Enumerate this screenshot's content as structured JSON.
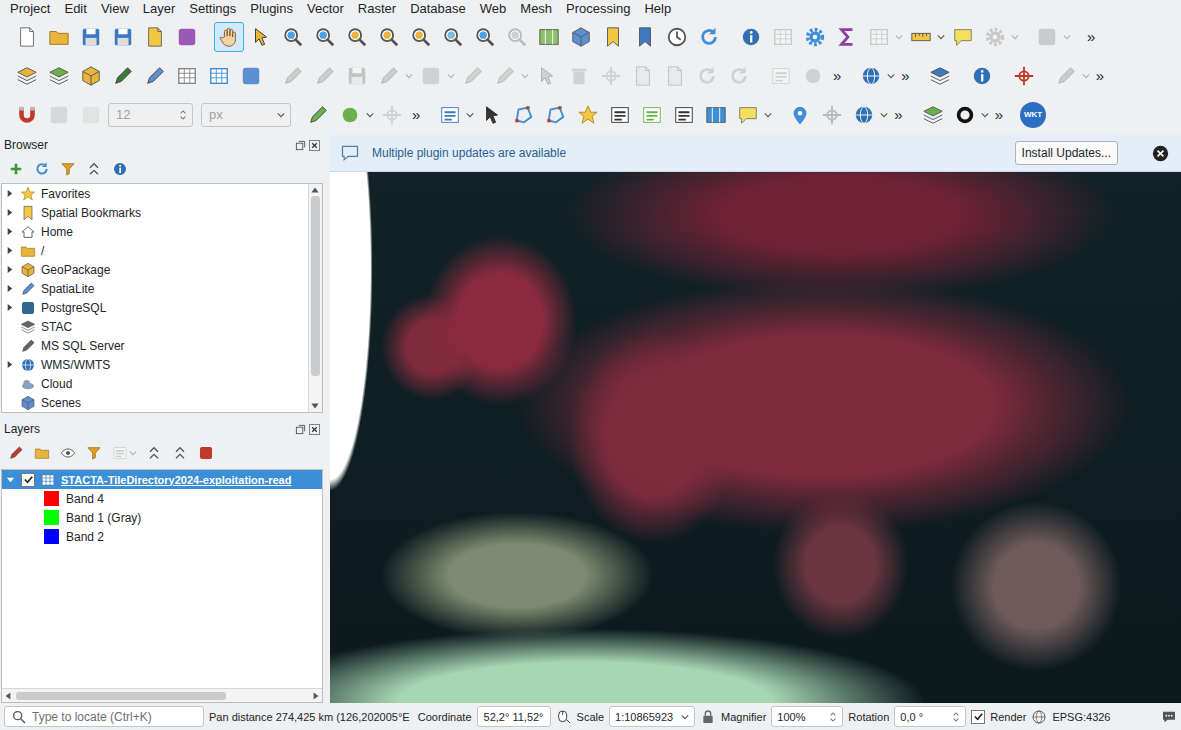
{
  "menu_bar": [
    "Project",
    "Edit",
    "View",
    "Layer",
    "Settings",
    "Plugins",
    "Vector",
    "Raster",
    "Database",
    "Web",
    "Mesh",
    "Processing",
    "Help"
  ],
  "toolbars": [
    {
      "groups": [
        [
          {
            "kind": "button",
            "disabled": false,
            "selected": false
          },
          {
            "kind": "button",
            "disabled": false,
            "selected": false
          },
          {
            "kind": "button",
            "disabled": false,
            "selected": false
          },
          {
            "kind": "button",
            "disabled": false,
            "selected": false
          },
          {
            "kind": "button",
            "disabled": false,
            "selected": false
          },
          {
            "kind": "button",
            "disabled": false,
            "selected": false
          }
        ],
        [
          {
            "kind": "button",
            "disabled": false,
            "selected": true
          },
          {
            "kind": "button",
            "disabled": false,
            "selected": false
          },
          {
            "kind": "button",
            "disabled": false,
            "selected": false
          },
          {
            "kind": "button",
            "disabled": false,
            "selected": false
          },
          {
            "kind": "button",
            "disabled": false,
            "selected": false
          },
          {
            "kind": "button",
            "disabled": false,
            "selected": false
          },
          {
            "kind": "button",
            "disabled": false,
            "selected": false
          },
          {
            "kind": "button",
            "disabled": false,
            "selected": false
          },
          {
            "kind": "button",
            "disabled": false,
            "selected": false
          },
          {
            "kind": "button",
            "disabled": true,
            "selected": false
          },
          {
            "kind": "button",
            "disabled": false,
            "selected": false
          },
          {
            "kind": "button",
            "disabled": false,
            "selected": false
          },
          {
            "kind": "button",
            "disabled": false,
            "selected": false
          },
          {
            "kind": "button",
            "disabled": false,
            "selected": false
          },
          {
            "kind": "button",
            "disabled": false,
            "selected": false
          },
          {
            "kind": "button",
            "disabled": false,
            "selected": false
          }
        ],
        [
          {
            "kind": "button",
            "disabled": false,
            "selected": false
          },
          {
            "kind": "button",
            "disabled": true,
            "selected": false
          },
          {
            "kind": "button",
            "disabled": false,
            "selected": false
          },
          {
            "kind": "button",
            "disabled": false,
            "selected": false
          },
          {
            "kind": "split",
            "disabled": true,
            "selected": false
          },
          {
            "kind": "split",
            "disabled": false,
            "selected": false
          },
          {
            "kind": "button",
            "disabled": false,
            "selected": false
          },
          {
            "kind": "split",
            "disabled": true,
            "selected": false
          }
        ],
        [
          {
            "kind": "split",
            "disabled": true,
            "selected": false
          }
        ],
        [
          {
            "kind": "overflow",
            "text": "»"
          }
        ]
      ]
    },
    {
      "groups": [
        [
          {
            "kind": "button",
            "disabled": false,
            "selected": false
          },
          {
            "kind": "button",
            "disabled": false,
            "selected": false
          },
          {
            "kind": "button",
            "disabled": false,
            "selected": false
          },
          {
            "kind": "button",
            "disabled": false,
            "selected": false
          },
          {
            "kind": "button",
            "disabled": false,
            "selected": false
          },
          {
            "kind": "button",
            "disabled": false,
            "selected": false
          },
          {
            "kind": "button",
            "disabled": false,
            "selected": false
          },
          {
            "kind": "button",
            "disabled": false,
            "selected": false
          }
        ],
        [
          {
            "kind": "button",
            "disabled": true,
            "selected": false
          },
          {
            "kind": "button",
            "disabled": true,
            "selected": false
          },
          {
            "kind": "button",
            "disabled": true,
            "selected": false
          },
          {
            "kind": "split",
            "disabled": true,
            "selected": false
          },
          {
            "kind": "split",
            "disabled": true,
            "selected": false
          },
          {
            "kind": "button",
            "disabled": true,
            "selected": false
          },
          {
            "kind": "split",
            "disabled": true,
            "selected": false
          },
          {
            "kind": "button",
            "disabled": true,
            "selected": false
          },
          {
            "kind": "button",
            "disabled": true,
            "selected": false
          },
          {
            "kind": "button",
            "disabled": true,
            "selected": false
          },
          {
            "kind": "button",
            "disabled": true,
            "selected": false
          },
          {
            "kind": "button",
            "disabled": true,
            "selected": false
          },
          {
            "kind": "button",
            "disabled": true,
            "selected": false
          },
          {
            "kind": "button",
            "disabled": true,
            "selected": false
          }
        ],
        [
          {
            "kind": "button",
            "disabled": true,
            "selected": false
          },
          {
            "kind": "button",
            "disabled": true,
            "selected": false
          },
          {
            "kind": "overflow",
            "text": "»"
          }
        ],
        [
          {
            "kind": "split",
            "disabled": false,
            "selected": false
          },
          {
            "kind": "overflow",
            "text": "»"
          }
        ],
        [
          {
            "kind": "button",
            "disabled": false,
            "selected": false
          }
        ],
        [
          {
            "kind": "button",
            "disabled": false,
            "selected": false
          }
        ],
        [
          {
            "kind": "button",
            "disabled": false,
            "selected": false
          }
        ],
        [
          {
            "kind": "split",
            "disabled": true,
            "selected": false
          },
          {
            "kind": "overflow",
            "text": "»"
          }
        ]
      ]
    },
    {
      "groups": [
        [
          {
            "kind": "button",
            "disabled": false,
            "selected": false
          },
          {
            "kind": "button",
            "disabled": true,
            "selected": false
          },
          {
            "kind": "button",
            "disabled": true,
            "selected": false
          },
          {
            "kind": "spin",
            "text": "12",
            "disabled": true
          },
          {
            "kind": "combo",
            "text": "px",
            "disabled": true
          }
        ],
        [
          {
            "kind": "button",
            "disabled": false,
            "selected": false
          },
          {
            "kind": "split",
            "disabled": false,
            "selected": false
          },
          {
            "kind": "button",
            "disabled": true,
            "selected": false
          },
          {
            "kind": "overflow",
            "text": "»"
          }
        ],
        [
          {
            "kind": "split",
            "disabled": false,
            "selected": false
          },
          {
            "kind": "button",
            "disabled": false,
            "selected": false
          },
          {
            "kind": "button",
            "disabled": false,
            "selected": false
          },
          {
            "kind": "button",
            "disabled": false,
            "selected": false
          },
          {
            "kind": "button",
            "disabled": false,
            "selected": false
          },
          {
            "kind": "button",
            "disabled": false,
            "selected": false
          },
          {
            "kind": "button",
            "disabled": false,
            "selected": false
          },
          {
            "kind": "button",
            "disabled": false,
            "selected": false
          },
          {
            "kind": "button",
            "disabled": false,
            "selected": false
          },
          {
            "kind": "split",
            "disabled": false,
            "selected": false
          }
        ],
        [
          {
            "kind": "button",
            "disabled": false,
            "selected": false
          },
          {
            "kind": "button",
            "disabled": true,
            "selected": false
          },
          {
            "kind": "split",
            "disabled": false,
            "selected": false
          },
          {
            "kind": "overflow",
            "text": "»"
          }
        ],
        [
          {
            "kind": "button",
            "disabled": false,
            "selected": false
          },
          {
            "kind": "split",
            "disabled": false,
            "selected": false
          },
          {
            "kind": "overflow",
            "text": "»"
          }
        ],
        [
          {
            "kind": "badge",
            "text": "WKT",
            "disabled": false,
            "selected": false
          }
        ]
      ]
    }
  ],
  "browser": {
    "title": "Browser",
    "tools": [
      {
        "kind": "button",
        "disabled": false
      },
      {
        "kind": "button",
        "disabled": false
      },
      {
        "kind": "button",
        "disabled": false
      },
      {
        "kind": "button",
        "disabled": false
      },
      {
        "kind": "button",
        "disabled": false
      }
    ],
    "items": [
      {
        "label": "Favorites",
        "expandable": true,
        "expanded": false
      },
      {
        "label": "Spatial Bookmarks",
        "expandable": true,
        "expanded": false
      },
      {
        "label": "Home",
        "expandable": true,
        "expanded": false
      },
      {
        "label": "/",
        "expandable": true,
        "expanded": false
      },
      {
        "label": "GeoPackage",
        "expandable": true,
        "expanded": false
      },
      {
        "label": "SpatiaLite",
        "expandable": true,
        "expanded": false
      },
      {
        "label": "PostgreSQL",
        "expandable": true,
        "expanded": false
      },
      {
        "label": "STAC",
        "expandable": false,
        "expanded": false
      },
      {
        "label": "MS SQL Server",
        "expandable": false,
        "expanded": false
      },
      {
        "label": "WMS/WMTS",
        "expandable": true,
        "expanded": false
      },
      {
        "label": "Cloud",
        "expandable": false,
        "expanded": false
      },
      {
        "label": "Scenes",
        "expandable": false,
        "expanded": false
      }
    ],
    "scrollbar": {
      "level": 0.88
    }
  },
  "layers": {
    "title": "Layers",
    "tools": [
      {
        "kind": "button",
        "disabled": false
      },
      {
        "kind": "button",
        "disabled": false
      },
      {
        "kind": "button",
        "disabled": false
      },
      {
        "kind": "button",
        "disabled": false
      },
      {
        "kind": "split",
        "disabled": true
      },
      {
        "kind": "button",
        "disabled": false
      },
      {
        "kind": "button",
        "disabled": false
      },
      {
        "kind": "button",
        "disabled": false
      }
    ],
    "items": [
      {
        "name": "STACTA-TileDirectory2024-exploitation-read",
        "checked": true,
        "expanded": true,
        "selected": true,
        "legend": [
          {
            "label": "Band 4",
            "color": "#ff0000"
          },
          {
            "label": "Band 1 (Gray)",
            "color": "#00ff00"
          },
          {
            "label": "Band 2",
            "color": "#0000ff"
          }
        ]
      }
    ],
    "scrollbar": {
      "level": 0.72
    }
  },
  "message_bar": {
    "text": "Multiple plugin updates are available",
    "button": "Install Updates..."
  },
  "status_bar": {
    "locate_placeholder": "Type to locate (Ctrl+K)",
    "info": "Pan distance 274,425 km (126,202005°E",
    "coordinate_label": "Coordinate",
    "coordinate": "52,2° 11,52°",
    "scale_label": "Scale",
    "scale": "1:10865923",
    "magnifier_label": "Magnifier",
    "magnifier": "100%",
    "rotation_label": "Rotation",
    "rotation": "0,0 °",
    "render_label": "Render",
    "render_checked": true,
    "crs": "EPSG:4326"
  }
}
